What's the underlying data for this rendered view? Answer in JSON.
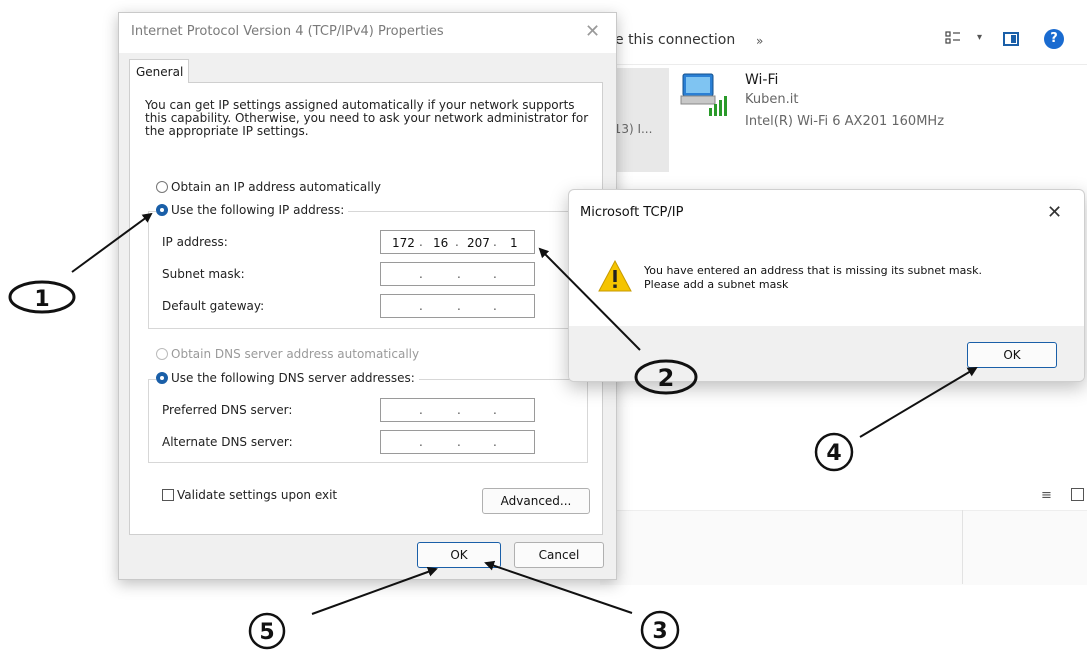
{
  "explorer": {
    "toolbar_connection_label": "e this connection",
    "toolbar_more": "»",
    "left_item_label": "(13) I...",
    "wifi_name": "Wi-Fi",
    "wifi_network": "Kuben.it",
    "wifi_adapter": "Intel(R) Wi-Fi 6 AX201 160MHz",
    "status_icon": "≡",
    "help_glyph": "?"
  },
  "ipv4": {
    "title": "Internet Protocol Version 4 (TCP/IPv4) Properties",
    "close_glyph": "✕",
    "tab_general": "General",
    "intro": "You can get IP settings assigned automatically if your network supports this capability. Otherwise, you need to ask your network administrator for the appropriate IP settings.",
    "radio_auto_ip": "Obtain an IP address automatically",
    "radio_manual_ip": "Use the following IP address:",
    "ip_label": "IP address:",
    "ip_octets": [
      "172",
      "16",
      "207",
      "1"
    ],
    "subnet_label": "Subnet mask:",
    "gateway_label": "Default gateway:",
    "radio_auto_dns": "Obtain DNS server address automatically",
    "radio_manual_dns": "Use the following DNS server addresses:",
    "preferred_dns_label": "Preferred DNS server:",
    "alternate_dns_label": "Alternate DNS server:",
    "validate_label": "Validate settings upon exit",
    "advanced_button": "Advanced...",
    "ok_button": "OK",
    "cancel_button": "Cancel"
  },
  "msgbox": {
    "title": "Microsoft TCP/IP",
    "close_glyph": "✕",
    "line1": "You have entered an address that is missing its subnet mask.",
    "line2": "Please add a subnet mask",
    "ok_button": "OK"
  },
  "callouts": [
    "1",
    "2",
    "3",
    "4",
    "5"
  ],
  "colors": {
    "accent": "#1a5fa8",
    "warning": "#f5c400"
  }
}
